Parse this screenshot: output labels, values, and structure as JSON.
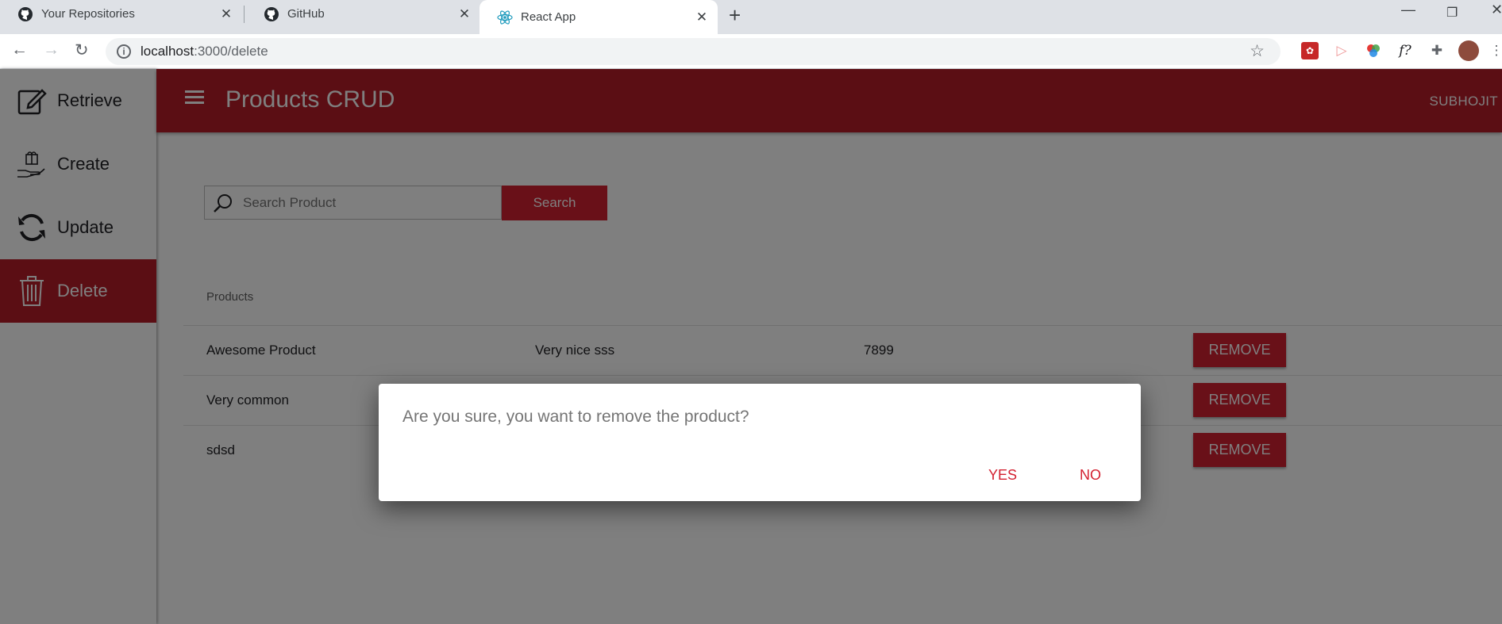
{
  "browser": {
    "tabs": [
      {
        "title": "Your Repositories",
        "icon": "github-icon"
      },
      {
        "title": "GitHub",
        "icon": "github-icon"
      },
      {
        "title": "React App",
        "icon": "react-icon"
      }
    ],
    "address": {
      "host": "localhost",
      "path": ":3000/delete"
    }
  },
  "sidebar": {
    "items": [
      {
        "label": "Retrieve",
        "icon": "edit-icon"
      },
      {
        "label": "Create",
        "icon": "gift-hand-icon"
      },
      {
        "label": "Update",
        "icon": "refresh-icon"
      },
      {
        "label": "Delete",
        "icon": "trash-icon"
      }
    ],
    "active": "Delete"
  },
  "appbar": {
    "title": "Products CRUD",
    "user": "SUBHOJIT"
  },
  "search": {
    "placeholder": "Search Product",
    "button_label": "Search"
  },
  "products": {
    "header": "Products",
    "rows": [
      {
        "name": "Awesome Product",
        "description": "Very nice sss",
        "price": "7899"
      },
      {
        "name": "Very common",
        "description": "",
        "price": ""
      },
      {
        "name": "sdsd",
        "description": "",
        "price": ""
      }
    ],
    "remove_label": "REMOVE"
  },
  "dialog": {
    "message": "Are you sure, you want to remove the product?",
    "yes_label": "YES",
    "no_label": "NO"
  },
  "colors": {
    "primary": "#b71c28",
    "button": "#d32030",
    "backdrop": "rgba(0,0,0,0.5)"
  }
}
